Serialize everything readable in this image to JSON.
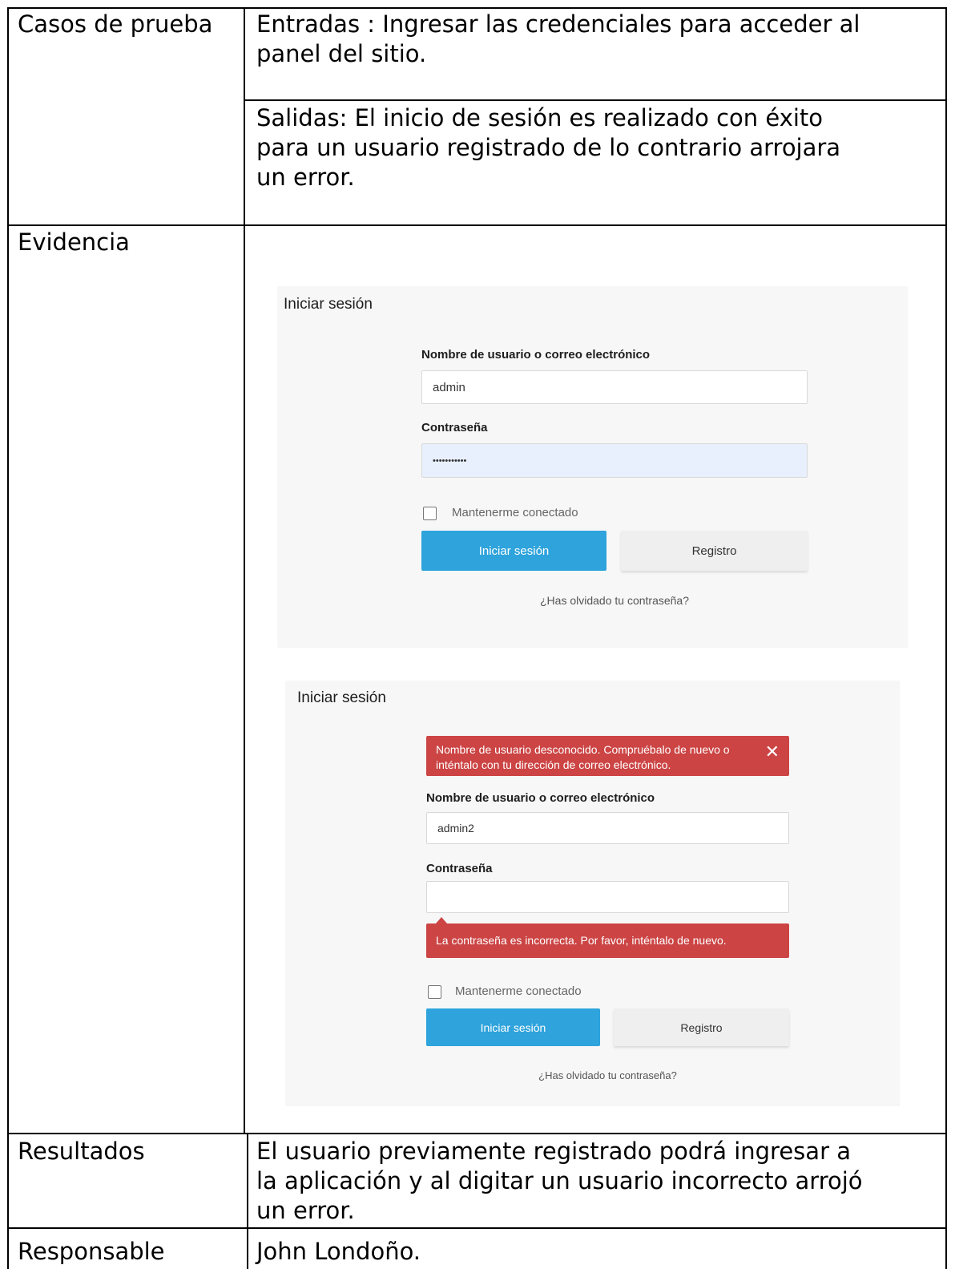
{
  "table": {
    "rows": {
      "casos_label": "Casos de prueba",
      "entradas_line1": "Entradas : Ingresar las credenciales para acceder al",
      "entradas_line2": "panel del sitio.",
      "salidas_line1": "Salidas: El inicio de sesión es realizado con éxito",
      "salidas_line2": "para un usuario registrado de lo contrario arrojara",
      "salidas_line3": "un error.",
      "evidencia_label": "Evidencia",
      "resultados_label": "Resultados",
      "resultados_line1": "El usuario previamente registrado podrá ingresar a",
      "resultados_line2": "la aplicación y al digitar un usuario incorrecto arrojó",
      "resultados_line3": "un error.",
      "responsable_label": "Responsable",
      "responsable_value": "John Londoño."
    }
  },
  "login1": {
    "title": "Iniciar sesión",
    "username_label": "Nombre de usuario o correo electrónico",
    "username_value": "admin",
    "password_label": "Contraseña",
    "password_value": "•••••••••••",
    "remember_label": "Mantenerme conectado",
    "login_button": "Iniciar sesión",
    "register_button": "Registro",
    "forgot_link": "¿Has olvidado tu contraseña?"
  },
  "login2": {
    "title": "Iniciar sesión",
    "error_line1": "Nombre de usuario desconocido. Compruébalo de nuevo o",
    "error_line2": "inténtalo con tu dirección de correo electrónico.",
    "close_glyph": "✕",
    "username_label": "Nombre de usuario o correo electrónico",
    "username_value": "admin2",
    "password_label": "Contraseña",
    "password_value": "",
    "password_error": "La contraseña es incorrecta. Por favor, inténtalo de nuevo.",
    "remember_label": "Mantenerme conectado",
    "login_button": "Iniciar sesión",
    "register_button": "Registro",
    "forgot_link": "¿Has olvidado tu contraseña?"
  },
  "colors": {
    "primary_button": "#2ea3dc",
    "error": "#cc4444",
    "autofill": "#e8f0fe",
    "panel_bg": "#f7f7f7"
  }
}
